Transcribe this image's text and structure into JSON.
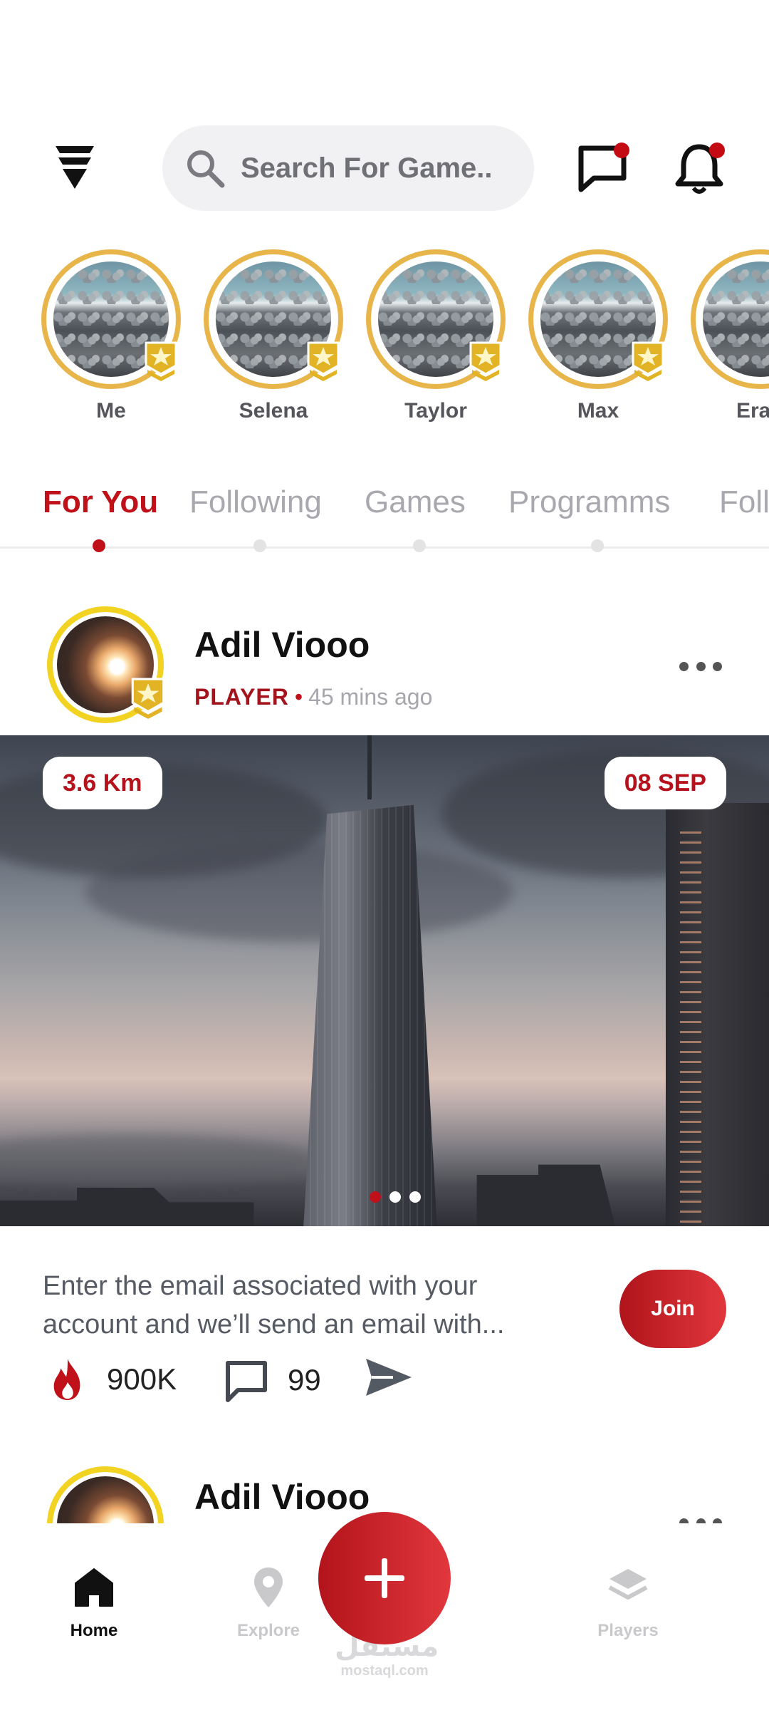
{
  "header": {
    "logo_icon": "app-logo-icon",
    "search_placeholder": "Search For Game..",
    "messages_icon": "chat-icon",
    "notifications_icon": "bell-icon",
    "accent_color": "#c0111a"
  },
  "stories": [
    {
      "name": "Me"
    },
    {
      "name": "Selena"
    },
    {
      "name": "Taylor"
    },
    {
      "name": "Max"
    },
    {
      "name": "Era"
    }
  ],
  "tabs": [
    {
      "label": "For You",
      "active": true
    },
    {
      "label": "Following",
      "active": false
    },
    {
      "label": "Games",
      "active": false
    },
    {
      "label": "Programms",
      "active": false
    },
    {
      "label": "Foll",
      "active": false
    }
  ],
  "post": {
    "author": "Adil Viooo",
    "role": "PLAYER",
    "time": "45 mins ago",
    "distance": "3.6 Km",
    "date": "08 SEP",
    "image_page_count": 3,
    "image_page_active": 1,
    "description_line1": "Enter the email associated with your",
    "description_line2": "account and we’ll send an email with...",
    "join_label": "Join",
    "likes": "900K",
    "comments": "99"
  },
  "next_post": {
    "author": "Adil Viooo"
  },
  "bottom_nav": {
    "items": [
      {
        "label": "Home",
        "icon": "home-icon",
        "active": true
      },
      {
        "label": "Explore",
        "icon": "location-pin-icon",
        "active": false
      },
      {
        "label": "Players",
        "icon": "layers-icon",
        "active": false
      }
    ],
    "fab_icon": "plus-icon"
  },
  "watermark": {
    "arabic": "مستقل",
    "latin": "mostaql.com"
  }
}
